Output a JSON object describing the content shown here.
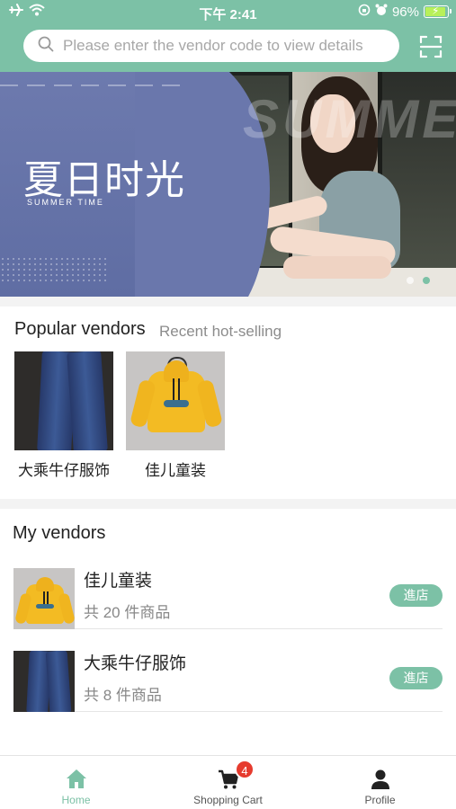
{
  "status_bar": {
    "time": "下午 2:41",
    "battery_text": "96%",
    "battery_level": 0.96
  },
  "search": {
    "placeholder": "Please enter the vendor code to view details"
  },
  "banner": {
    "title": "夏日时光",
    "subtitle": "SUMMER TIME",
    "watermark": "SUMMER",
    "slide_count": 2,
    "active_slide": 1
  },
  "popular": {
    "title": "Popular vendors",
    "subtitle": "Recent hot-selling",
    "items": [
      {
        "name": "大乘牛仔服饰",
        "image": "jeans"
      },
      {
        "name": "佳儿童装",
        "image": "hoodie"
      }
    ]
  },
  "my_vendors": {
    "title": "My vendors",
    "items": [
      {
        "name": "佳儿童装",
        "count_text": "共 20 件商品",
        "button": "進店",
        "image": "hoodie"
      },
      {
        "name": "大乘牛仔服饰",
        "count_text": "共 8 件商品",
        "button": "進店",
        "image": "jeans"
      }
    ]
  },
  "tabbar": {
    "items": [
      {
        "label": "Home",
        "icon": "home-icon",
        "active": true
      },
      {
        "label": "Shopping Cart",
        "icon": "cart-icon",
        "badge": "4"
      },
      {
        "label": "Profile",
        "icon": "user-icon"
      }
    ]
  },
  "colors": {
    "accent": "#7cc1a6",
    "badge": "#e63b2e",
    "banner": "#6a77ac"
  }
}
